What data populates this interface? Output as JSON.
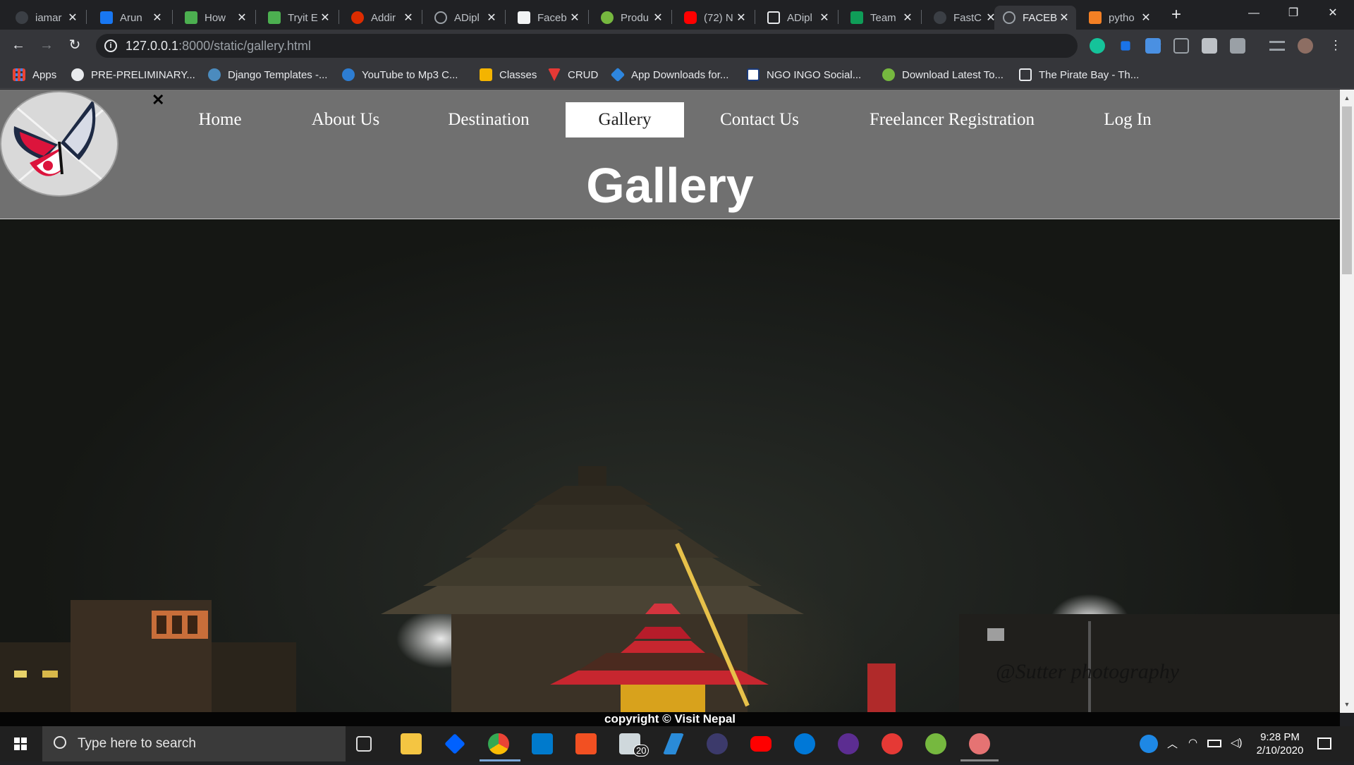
{
  "browser": {
    "tabs": [
      {
        "label": "iamar",
        "icon": "github-icon",
        "color": "#6e7681"
      },
      {
        "label": "Arun",
        "icon": "facebook-icon",
        "color": "#1877f2"
      },
      {
        "label": "How",
        "icon": "w3schools-icon",
        "color": "#4caf50"
      },
      {
        "label": "Tryit E",
        "icon": "w3schools-icon",
        "color": "#4caf50"
      },
      {
        "label": "Addir",
        "icon": "angular-gear-icon",
        "color": "#dd2c00"
      },
      {
        "label": "ADipl",
        "icon": "globe-icon",
        "color": "#9aa0a6"
      },
      {
        "label": "Faceb",
        "icon": "photo-icon",
        "color": "#f1f3f4"
      },
      {
        "label": "Produ",
        "icon": "utorrent-icon",
        "color": "#76b83f"
      },
      {
        "label": "(72) N",
        "icon": "youtube-icon",
        "color": "#ff0000"
      },
      {
        "label": "ADipl",
        "icon": "document-icon",
        "color": "#e8eaed"
      },
      {
        "label": "Team",
        "icon": "sheets-icon",
        "color": "#0f9d58"
      },
      {
        "label": "FastC",
        "icon": "github-icon",
        "color": "#6e7681"
      },
      {
        "label": "FACEB",
        "icon": "globe-icon",
        "color": "#9aa0a6",
        "active": true
      },
      {
        "label": "pytho",
        "icon": "stackoverflow-icon",
        "color": "#f48024"
      }
    ],
    "url_host": "127.0.0.1",
    "url_path": ":8000/static/gallery.html",
    "info_glyph": "i",
    "bookmarks": [
      {
        "label": "Apps",
        "icon": "apps-grid-icon",
        "color": "#4285f4"
      },
      {
        "label": "PRE-PRELIMINARY...",
        "icon": "globe-icon",
        "color": "#e8eaed"
      },
      {
        "label": "Django Templates -...",
        "icon": "django-icon",
        "color": "#4b8bbe"
      },
      {
        "label": "YouTube to Mp3 C...",
        "icon": "download-cloud-icon",
        "color": "#2d7dd2"
      },
      {
        "label": "Classes",
        "icon": "classroom-icon",
        "color": "#f4b400"
      },
      {
        "label": "CRUD",
        "icon": "crud-icon",
        "color": "#e53935"
      },
      {
        "label": "App Downloads for...",
        "icon": "app-download-icon",
        "color": "#2e86de"
      },
      {
        "label": "NGO INGO Social...",
        "icon": "ngo-icon",
        "color": "#ffffff"
      },
      {
        "label": "Download Latest To...",
        "icon": "utorrent-icon",
        "color": "#76b83f"
      },
      {
        "label": "The Pirate Bay - Th...",
        "icon": "pirate-icon",
        "color": "#e8eaed"
      }
    ]
  },
  "site": {
    "nav": [
      {
        "label": "Home"
      },
      {
        "label": "About Us"
      },
      {
        "label": "Destination"
      },
      {
        "label": "Gallery",
        "active": true
      },
      {
        "label": "Contact Us"
      },
      {
        "label": "Freelancer Registration"
      },
      {
        "label": "Log In"
      }
    ],
    "close_glyph": "✕",
    "page_title": "Gallery",
    "hero_watermark": "@Sutter photography",
    "footer": "copyright © Visit Nepal"
  },
  "taskbar": {
    "search_placeholder": "Type here to search",
    "mail_badge": "20",
    "time": "9:28 PM",
    "date": "2/10/2020"
  }
}
